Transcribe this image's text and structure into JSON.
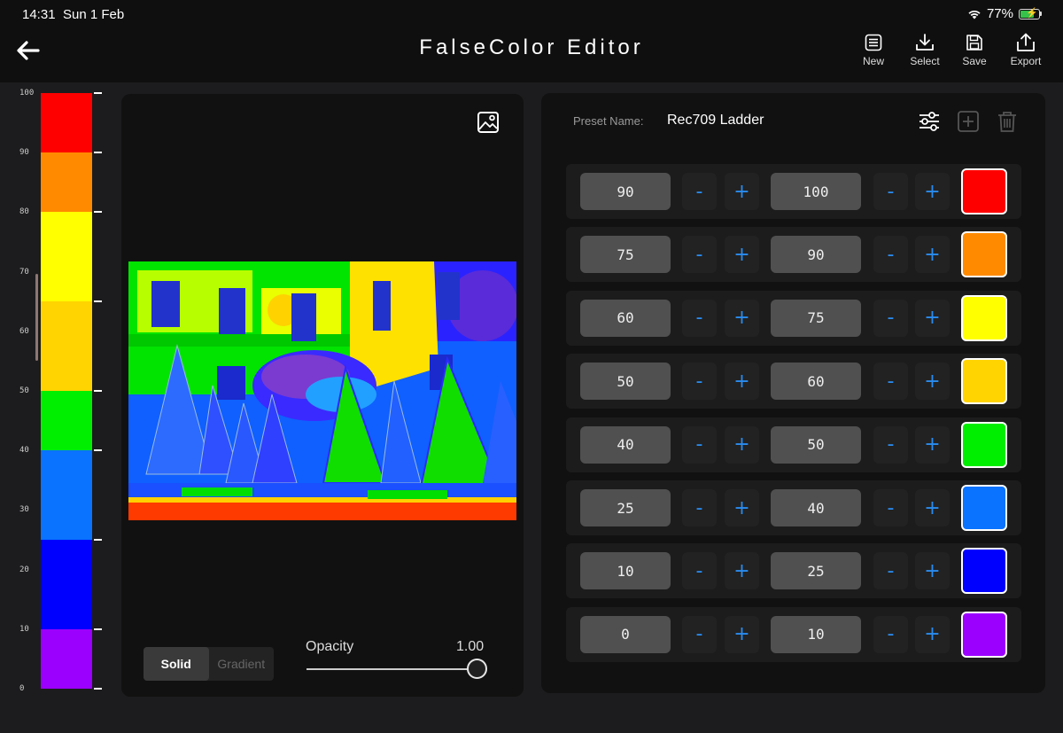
{
  "status": {
    "time": "14:31",
    "date": "Sun 1 Feb",
    "battery": "77%"
  },
  "nav": {
    "title": "FalseColor Editor",
    "buttons": {
      "new": "New",
      "select": "Select",
      "save": "Save",
      "export": "Export"
    }
  },
  "scale": {
    "labels": [
      "100",
      "90",
      "80",
      "70",
      "60",
      "50",
      "40",
      "30",
      "20",
      "10",
      "0"
    ],
    "segments": [
      {
        "from": 90,
        "to": 100,
        "color": "#ff0000"
      },
      {
        "from": 80,
        "to": 90,
        "color": "#ff8a00"
      },
      {
        "from": 65,
        "to": 80,
        "color": "#ffff00"
      },
      {
        "from": 50,
        "to": 65,
        "color": "#ffd400"
      },
      {
        "from": 40,
        "to": 50,
        "color": "#00ee00"
      },
      {
        "from": 25,
        "to": 40,
        "color": "#0a73ff"
      },
      {
        "from": 10,
        "to": 25,
        "color": "#0000ff"
      },
      {
        "from": 0,
        "to": 10,
        "color": "#9b00ff"
      }
    ]
  },
  "preview": {
    "mode": {
      "solid": "Solid",
      "gradient": "Gradient",
      "active": "Solid"
    },
    "opacity_label": "Opacity",
    "opacity_value": "1.00",
    "opacity_fraction": 1.0
  },
  "preset": {
    "label": "Preset Name:",
    "name": "Rec709 Ladder",
    "rows": [
      {
        "low": "90",
        "high": "100",
        "color": "#ff0000"
      },
      {
        "low": "75",
        "high": "90",
        "color": "#ff8a00"
      },
      {
        "low": "60",
        "high": "75",
        "color": "#ffff00"
      },
      {
        "low": "50",
        "high": "60",
        "color": "#ffd400"
      },
      {
        "low": "40",
        "high": "50",
        "color": "#00ee00"
      },
      {
        "low": "25",
        "high": "40",
        "color": "#0a73ff"
      },
      {
        "low": "10",
        "high": "25",
        "color": "#0000ff"
      },
      {
        "low": "0",
        "high": "10",
        "color": "#9b00ff"
      }
    ],
    "minus": "-",
    "plus": "+"
  }
}
